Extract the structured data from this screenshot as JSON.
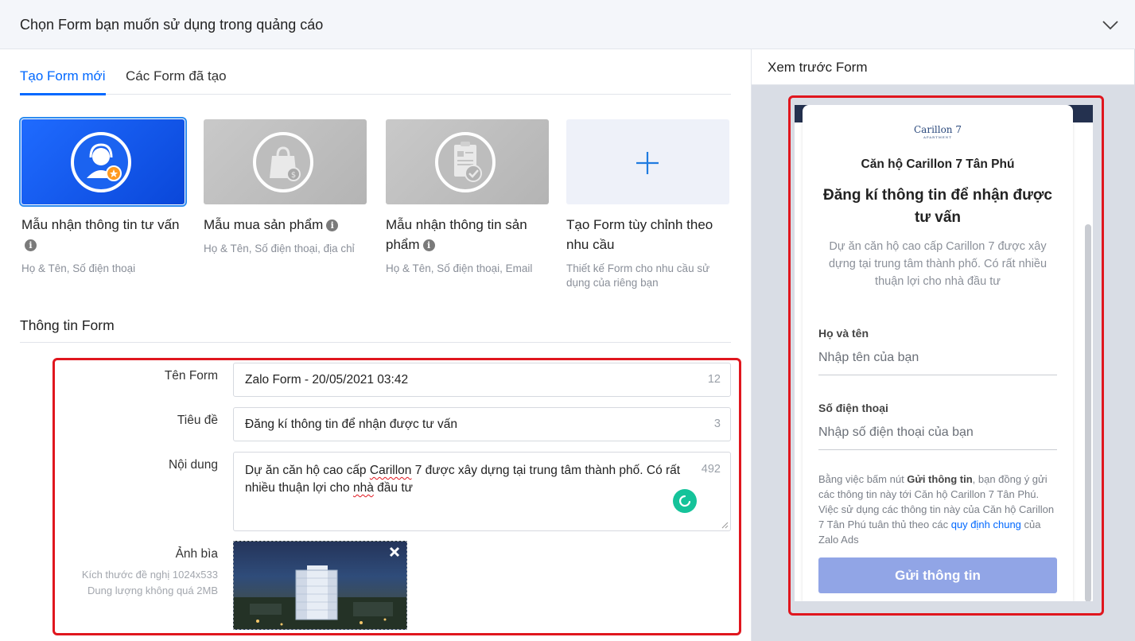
{
  "header": {
    "title": "Chọn Form bạn muốn sử dụng trong quảng cáo",
    "collapse_icon": "chevron-down-icon"
  },
  "tabs": [
    {
      "label": "Tạo Form mới",
      "active": true
    },
    {
      "label": "Các Form đã tạo",
      "active": false
    }
  ],
  "templates": [
    {
      "title": "Mẫu nhận thông tin tư vấn",
      "desc": "Họ & Tên, Số điện thoại",
      "icon": "support-agent-icon",
      "selected": true
    },
    {
      "title": "Mẫu mua sản phẩm",
      "desc": "Họ & Tên, Số điện thoại, địa chỉ",
      "icon": "shopping-bag-icon",
      "selected": false
    },
    {
      "title": "Mẫu nhận thông tin sản phẩm",
      "desc": "Họ & Tên, Số điện thoại, Email",
      "icon": "clipboard-check-icon",
      "selected": false
    },
    {
      "title": "Tạo Form tùy chỉnh theo nhu cầu",
      "desc": "Thiết kế Form cho nhu cầu sử dụng của riêng bạn",
      "icon": "plus-icon",
      "selected": false
    }
  ],
  "form_info": {
    "section_title": "Thông tin Form",
    "name": {
      "label": "Tên Form",
      "value": "Zalo Form - 20/05/2021 03:42",
      "count": "12"
    },
    "title": {
      "label": "Tiêu đề",
      "value": "Đăng kí thông tin để nhận được tư vấn",
      "count": "3"
    },
    "content": {
      "label": "Nội dung",
      "value_before": "Dự ăn căn hộ cao cấp ",
      "value_spell1": "Carillon",
      "value_mid": " 7 được xây dựng tại trung tâm thành phố. Có rất nhiều thuận lợi cho ",
      "value_spell2": "nhà",
      "value_after": " đầu tư",
      "count": "492"
    },
    "cover": {
      "label": "Ảnh bìa",
      "hint1": "Kích thước đề nghị 1024x533",
      "hint2": "Dung lượng không quá 2MB"
    }
  },
  "preview": {
    "title": "Xem trước Form",
    "logo_line1": "Carillon 7",
    "logo_line2": "APARTMENT",
    "brand": "Căn hộ Carillon 7 Tân Phú",
    "heading": "Đăng kí thông tin để nhận được tư vấn",
    "description": "Dự ăn căn hộ cao cấp Carillon 7 được xây dựng tại trung tâm thành phố. Có rất nhiều thuận lợi cho nhà đầu tư",
    "name_label": "Họ và tên",
    "name_placeholder": "Nhập tên của bạn",
    "phone_label": "Số điện thoại",
    "phone_placeholder": "Nhập số điện thoại của bạn",
    "terms_1": "Bằng việc bấm nút ",
    "terms_bold": "Gửi thông tin",
    "terms_2": ", bạn đồng ý gửi các thông tin này tới Căn hộ Carillon 7 Tân Phú. Việc sử dụng các thông tin này của Căn hộ Carillon 7 Tân Phú tuân thủ theo các ",
    "terms_link": "quy định chung",
    "terms_3": " của Zalo Ads",
    "submit": "Gửi thông tin"
  },
  "colors": {
    "accent": "#0068ff",
    "highlight": "#e0161e",
    "submit": "#91a5e6"
  }
}
